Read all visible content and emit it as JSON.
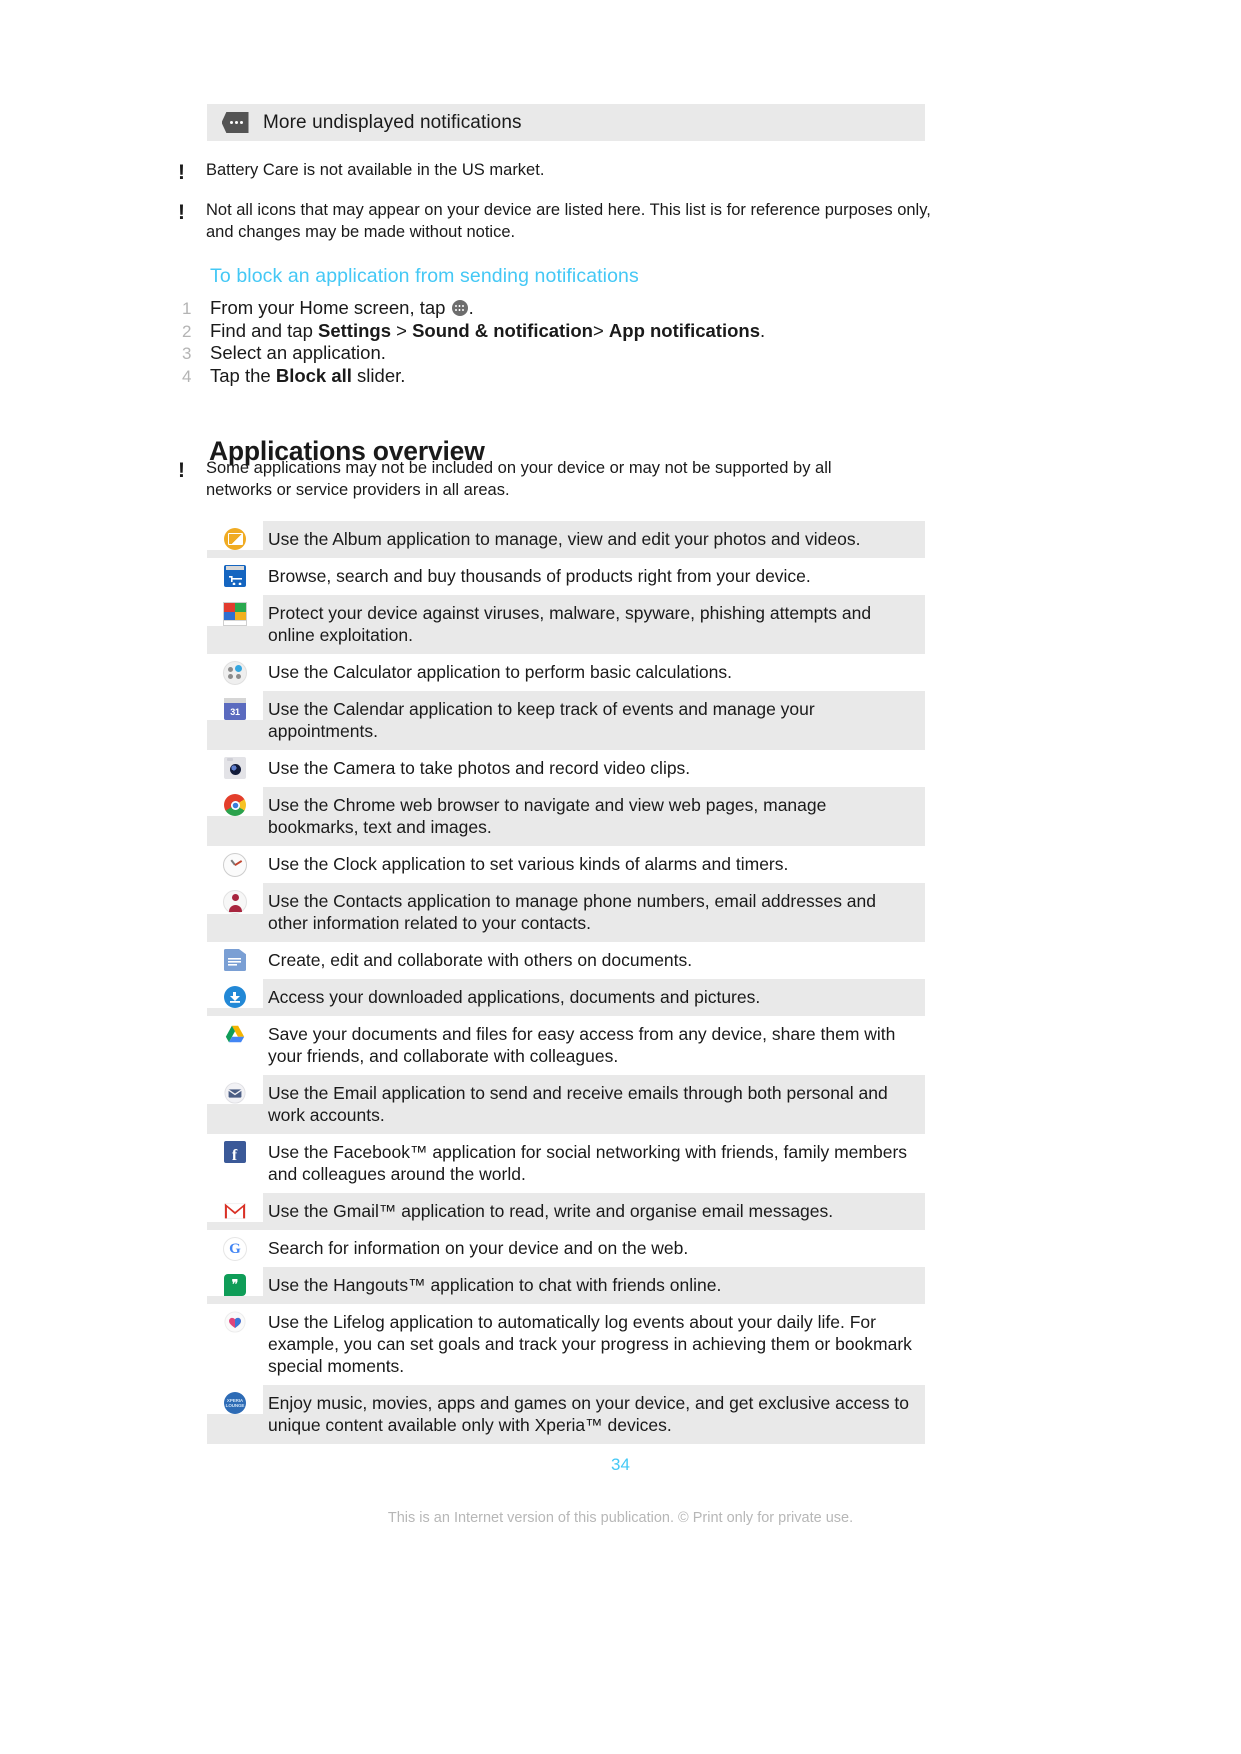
{
  "notification_banner": {
    "icon": "more-undisplayed-icon",
    "text": "More undisplayed notifications"
  },
  "notes": {
    "note1": "Battery Care is not available in the US market.",
    "note2": "Not all icons that may appear on your device are listed here. This list is for reference purposes only, and changes may be made without notice.",
    "note3": "Some applications may not be included on your device or may not be supported by all networks or service providers in all areas."
  },
  "task": {
    "heading": "To block an application from sending notifications",
    "steps": [
      {
        "num": "1",
        "pre": "From your Home screen, tap ",
        "icon": "app-tray-icon",
        "post": "."
      },
      {
        "num": "2",
        "pre": "Find and tap ",
        "b1": "Settings",
        "mid1": " > ",
        "b2": "Sound & notification",
        "mid2": "> ",
        "b3": "App notifications",
        "post": "."
      },
      {
        "num": "3",
        "pre": "Select an application.",
        "post": ""
      },
      {
        "num": "4",
        "pre": "Tap the ",
        "b1": "Block all",
        "post": " slider."
      }
    ]
  },
  "section": {
    "title": "Applications overview"
  },
  "applications": [
    {
      "icon": "album-icon",
      "shaded": true,
      "desc": "Use the Album application to manage, view and edit your photos and videos."
    },
    {
      "icon": "store-icon",
      "shaded": false,
      "desc": "Browse, search and buy thousands of products right from your device."
    },
    {
      "icon": "antivirus-icon",
      "shaded": true,
      "desc": "Protect your device against viruses, malware, spyware, phishing attempts and online exploitation."
    },
    {
      "icon": "calculator-icon",
      "shaded": false,
      "desc": "Use the Calculator application to perform basic calculations."
    },
    {
      "icon": "calendar-icon",
      "shaded": true,
      "desc": "Use the Calendar application to keep track of events and manage your appointments."
    },
    {
      "icon": "camera-icon",
      "shaded": false,
      "desc": "Use the Camera to take photos and record video clips."
    },
    {
      "icon": "chrome-icon",
      "shaded": true,
      "desc": "Use the Chrome web browser to navigate and view web pages, manage bookmarks, text and images."
    },
    {
      "icon": "clock-icon",
      "shaded": false,
      "desc": "Use the Clock application to set various kinds of alarms and timers."
    },
    {
      "icon": "contacts-icon",
      "shaded": true,
      "desc": "Use the Contacts application to manage phone numbers, email addresses and other information related to your contacts."
    },
    {
      "icon": "docs-icon",
      "shaded": false,
      "desc": "Create, edit and collaborate with others on documents."
    },
    {
      "icon": "downloads-icon",
      "shaded": true,
      "desc": "Access your downloaded applications, documents and pictures."
    },
    {
      "icon": "drive-icon",
      "shaded": false,
      "desc": "Save your documents and files for easy access from any device, share them with your friends, and collaborate with colleagues."
    },
    {
      "icon": "email-icon",
      "shaded": true,
      "desc": "Use the Email application to send and receive emails through both personal and work accounts."
    },
    {
      "icon": "facebook-icon",
      "shaded": false,
      "desc": "Use the Facebook™ application for social networking with friends, family members and colleagues around the world."
    },
    {
      "icon": "gmail-icon",
      "shaded": true,
      "desc": "Use the Gmail™ application to read, write and organise email messages."
    },
    {
      "icon": "google-icon",
      "shaded": false,
      "desc": "Search for information on your device and on the web."
    },
    {
      "icon": "hangouts-icon",
      "shaded": true,
      "desc": "Use the Hangouts™ application to chat with friends online."
    },
    {
      "icon": "lifelog-icon",
      "shaded": false,
      "desc": "Use the Lifelog application to automatically log events about your daily life. For example, you can set goals and track your progress in achieving them or bookmark special moments."
    },
    {
      "icon": "xperia-lounge-icon",
      "shaded": true,
      "desc": "Enjoy music, movies, apps and games on your device, and get exclusive access to unique content available only with Xperia™ devices."
    }
  ],
  "footer": {
    "page_number": "34",
    "note": "This is an Internet version of this publication. © Print only for private use."
  },
  "colors": {
    "accent_blue": "#44c8f5",
    "row_shade": "#e9e9e9",
    "text": "#1a1a1a",
    "footer_grey": "#b7b7b7",
    "step_number_grey": "#b4b4b4"
  },
  "icon_glyphs": {
    "calendar_day": "31",
    "facebook_letter": "f",
    "google_letter": "G",
    "hangouts_glyph": "❞",
    "xperia_lounge_label": "XPERIA LOUNGE"
  }
}
